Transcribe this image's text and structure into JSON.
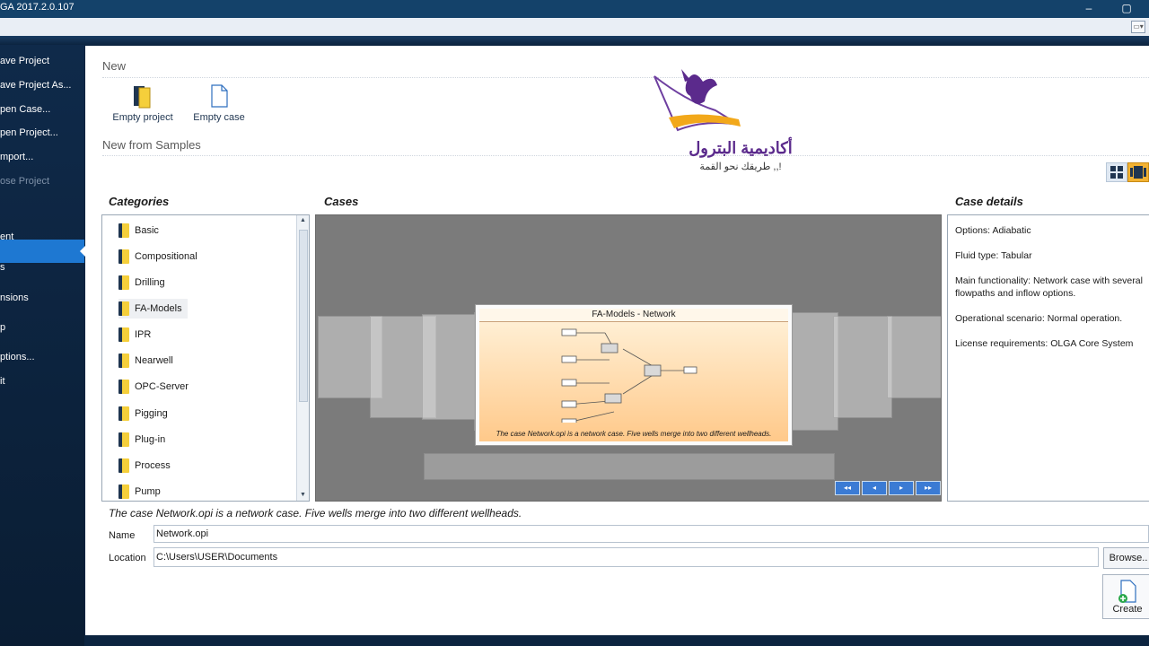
{
  "window": {
    "title": "GA 2017.2.0.107",
    "minimize": "–",
    "maximize": "▢"
  },
  "sidebar": {
    "items": [
      {
        "label": "ave Project"
      },
      {
        "label": "ave Project As..."
      },
      {
        "label": "pen Case..."
      },
      {
        "label": "pen Project..."
      },
      {
        "label": "mport..."
      },
      {
        "label": "ose Project"
      },
      {
        "label": "ent"
      },
      {
        "label": "s"
      },
      {
        "label": "nsions"
      },
      {
        "label": "p"
      },
      {
        "label": "ptions..."
      },
      {
        "label": "it"
      }
    ]
  },
  "new_section": {
    "title": "New",
    "tiles": [
      {
        "label": "Empty project"
      },
      {
        "label": "Empty case"
      }
    ]
  },
  "samples_section": {
    "title": "New from Samples"
  },
  "logo": {
    "line1": "أكاديمية البترول",
    "line2": "طريقك نحو القمة ,,!"
  },
  "categories": {
    "header": "Categories",
    "items": [
      "Basic",
      "Compositional",
      "Drilling",
      "FA-Models",
      "IPR",
      "Nearwell",
      "OPC-Server",
      "Pigging",
      "Plug-in",
      "Process",
      "Pump"
    ],
    "selected": "FA-Models"
  },
  "cases": {
    "header": "Cases",
    "card_title": "FA-Models  - Network",
    "card_desc": "The case Network.opi is a network case. Five wells merge into two different wellheads.",
    "nav": [
      "◂◂",
      "◂",
      "▸",
      "▸▸"
    ]
  },
  "case_details": {
    "header": "Case details",
    "lines": [
      "Options: Adiabatic",
      "Fluid type: Tabular",
      "Main functionality: Network case with several flowpaths and inflow options.",
      "Operational scenario: Normal operation.",
      "License requirements: OLGA Core System"
    ]
  },
  "status_text": "The case Network.opi is a network case. Five wells merge into two different wellheads.",
  "form": {
    "name_label": "Name",
    "name_value": "Network.opi",
    "location_label": "Location",
    "location_value": "C:\\Users\\USER\\Documents",
    "browse_label": "Browse..",
    "create_label": "Create"
  },
  "colors": {
    "accent": "#1e78d2",
    "title_bar": "#14426a",
    "card_gradient_end": "#ffc98a"
  }
}
